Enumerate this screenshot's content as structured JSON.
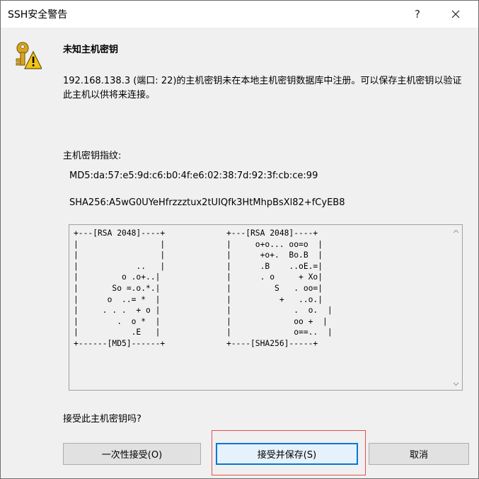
{
  "window": {
    "title": "SSH安全警告",
    "help_label": "?"
  },
  "header": {
    "heading": "未知主机密钥"
  },
  "message": {
    "text": "192.168.138.3 (端口: 22)的主机密钥未在本地主机密钥数据库中注册。可以保存主机密钥以验证此主机以供将来连接。"
  },
  "fingerprints": {
    "label": "主机密钥指纹:",
    "md5": "MD5:da:57:e5:9d:c6:b0:4f:e6:02:38:7d:92:3f:cb:ce:99",
    "sha256": "SHA256:A5wG0UYeHfrzzztux2tUIQfk3HtMhpBsXl82+fCyEB8"
  },
  "randomart": {
    "md5": "+---[RSA 2048]----+\n|                 |\n|                 |\n|            ..   |\n|         o .o+..|\n|       So =.o.*.|\n|      o  ..= *  |\n|     . . .  + o |\n|        .  o *  |\n|           .E   |\n+------[MD5]------+",
    "sha256": "+---[RSA 2048]----+\n|     o+o... oo=o  |\n|      +o+.  Bo.B  |\n|      .B    ..oE.=|\n|      . o     + Xo|\n|         S   . oo=|\n|          +   ..o.|\n|             .  o.  |\n|             oo +  |\n|             o==..  |\n+----[SHA256]-----+"
  },
  "footer": {
    "question": "接受此主机密钥吗?"
  },
  "buttons": {
    "once": "一次性接受(O)",
    "accept_save": "接受并保存(S)",
    "cancel": "取消"
  },
  "icons": {
    "warning": "key-warning-icon",
    "close": "close-icon",
    "scroll_up": "chevron-up-icon",
    "scroll_down": "chevron-down-icon"
  },
  "colors": {
    "focus_border": "#0078d7",
    "highlight_box": "#e05050",
    "warning_yellow": "#f2c318"
  }
}
